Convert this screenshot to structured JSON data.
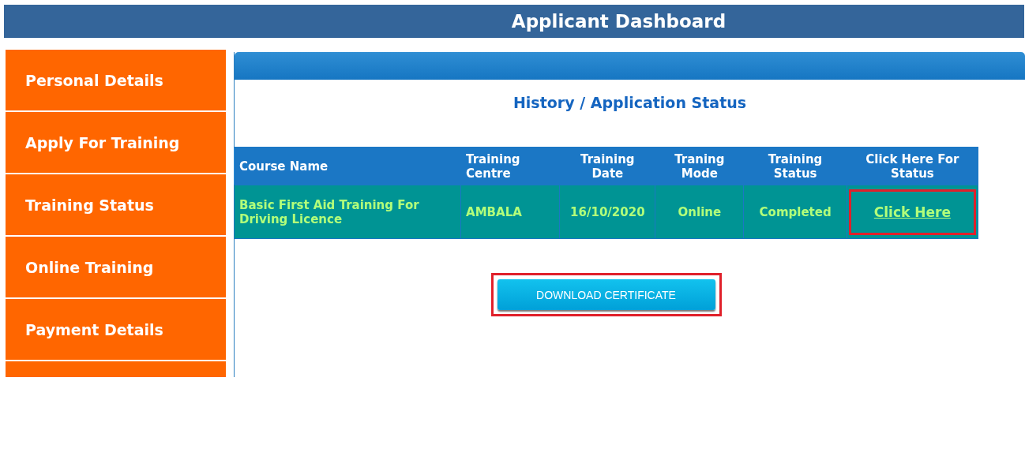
{
  "header": {
    "title": "Applicant Dashboard"
  },
  "sidebar": {
    "items": [
      {
        "label": "Personal Details"
      },
      {
        "label": "Apply For Training"
      },
      {
        "label": "Training Status"
      },
      {
        "label": "Online Training"
      },
      {
        "label": "Payment Details"
      }
    ]
  },
  "panel": {
    "title": "History / Application Status",
    "table": {
      "columns": [
        "Course Name",
        "Training Centre",
        "Training Date",
        "Traning Mode",
        "Training Status",
        "Click Here For Status"
      ],
      "rows": [
        {
          "cells": [
            "Basic First Aid Training For Driving Licence",
            "AMBALA",
            "16/10/2020",
            "Online",
            "Completed"
          ],
          "link": {
            "label": "Click Here",
            "highlighted": true
          }
        }
      ]
    },
    "button": {
      "label": "DOWNLOAD CERTIFICATE",
      "highlighted": true
    }
  }
}
